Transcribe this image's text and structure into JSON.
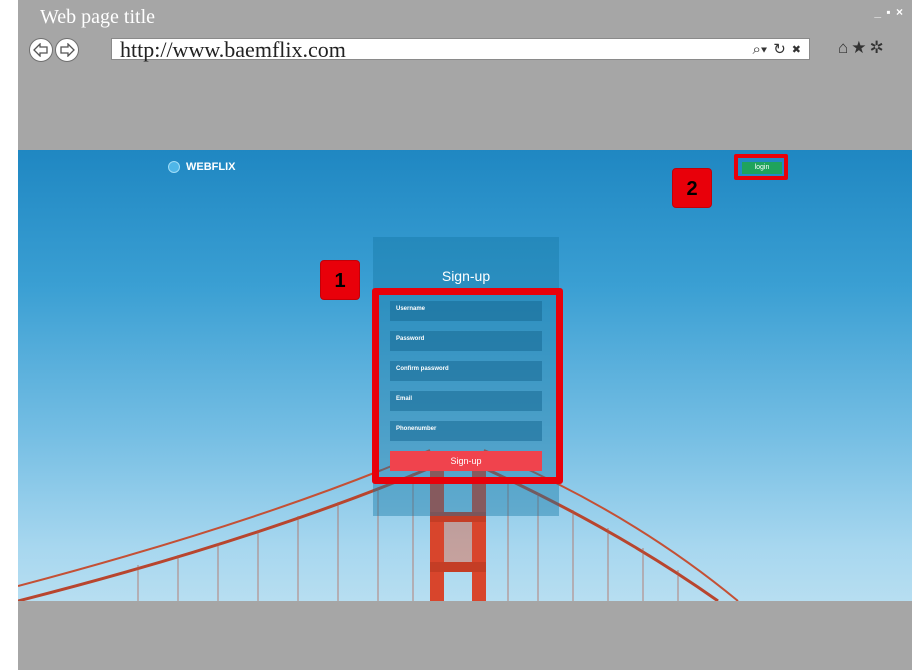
{
  "window": {
    "title": "Web page title",
    "controls": "_ ▪ ×"
  },
  "browser": {
    "back_icon": "back-arrow-icon",
    "forward_icon": "forward-arrow-icon",
    "url": "http://www.baemflix.com",
    "search_icon": "⌕▾",
    "refresh_icon": "↻",
    "stop_icon": "✖",
    "home_icon": "⌂",
    "favorites_icon": "★",
    "settings_icon": "✲"
  },
  "site": {
    "logo": "WEBFLIX",
    "login_label": "login"
  },
  "signup": {
    "title": "Sign-up",
    "fields": [
      {
        "placeholder": "Username"
      },
      {
        "placeholder": "Password"
      },
      {
        "placeholder": "Confirm password"
      },
      {
        "placeholder": "Email"
      },
      {
        "placeholder": "Phonenumber"
      }
    ],
    "submit_label": "Sign-up"
  },
  "annotations": {
    "badge_1": "1",
    "badge_2": "2",
    "highlight_color": "#e8000a"
  },
  "colors": {
    "sky": "#3a9fd3",
    "bridge": "#d8452c",
    "login": "#1fa35c",
    "submit": "#f0434d"
  }
}
